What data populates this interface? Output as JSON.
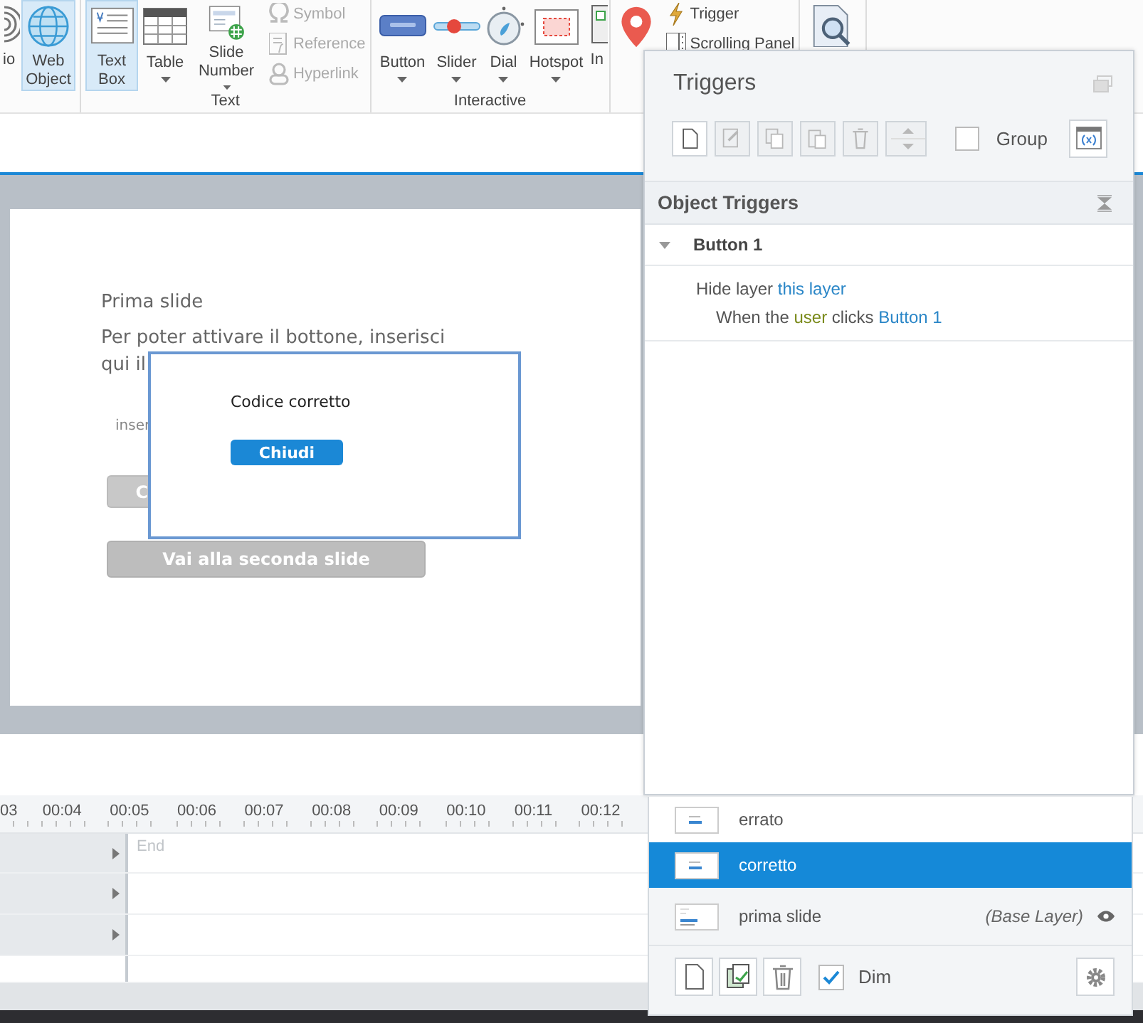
{
  "ribbon": {
    "groups": [
      {
        "tools": [
          {
            "label": "io",
            "selected": false,
            "dropdown": false
          },
          {
            "label": "Web Object",
            "selected": true,
            "dropdown": false
          }
        ]
      },
      {
        "label": "Text",
        "tools": [
          {
            "label": "Text Box",
            "selected": true,
            "dropdown": false
          },
          {
            "label": "Table",
            "selected": false,
            "dropdown": true
          },
          {
            "label": "Slide Number",
            "selected": false,
            "dropdown": true
          }
        ],
        "small_tools": [
          {
            "label": "Symbol",
            "disabled": true
          },
          {
            "label": "Reference",
            "disabled": true
          },
          {
            "label": "Hyperlink",
            "disabled": true
          }
        ]
      },
      {
        "label": "Interactive",
        "tools": [
          {
            "label": "Button",
            "selected": false,
            "dropdown": true
          },
          {
            "label": "Slider",
            "selected": false,
            "dropdown": true
          },
          {
            "label": "Dial",
            "selected": false,
            "dropdown": true
          },
          {
            "label": "Hotspot",
            "selected": false,
            "dropdown": true
          },
          {
            "label": "In",
            "selected": false,
            "dropdown": false
          }
        ]
      },
      {
        "tools": [
          {
            "selected": false,
            "dropdown": false
          }
        ],
        "small_tools": [
          {
            "label": "Trigger",
            "disabled": false
          },
          {
            "label": "Scrolling Panel",
            "disabled": false
          }
        ]
      },
      {
        "tools": [
          {
            "selected": false,
            "dropdown": false
          }
        ]
      }
    ]
  },
  "slide": {
    "title": "Prima slide",
    "body_lines": [
      "Per poter attivare il bottone, inserisci",
      "qui il"
    ],
    "field_text": "inser",
    "submit_button": {
      "label": "C",
      "disabled": true
    },
    "next_button": {
      "label": "Vai alla seconda slide",
      "disabled": true
    }
  },
  "dialog": {
    "message": "Codice corretto",
    "button": "Chiudi"
  },
  "timeline": {
    "ticks": [
      "03",
      "00:04",
      "00:05",
      "00:06",
      "00:07",
      "00:08",
      "00:09",
      "00:10",
      "00:11",
      "00:12"
    ],
    "end_label": "End",
    "rows": [
      {
        "expandable": true
      },
      {
        "expandable": true
      },
      {
        "expandable": true
      },
      {
        "expandable": false
      }
    ]
  },
  "triggers_panel": {
    "title": "Triggers",
    "toolbar": [
      {
        "disabled": false
      },
      {
        "disabled": true
      },
      {
        "disabled": true
      },
      {
        "disabled": true
      },
      {
        "disabled": true
      },
      {
        "disabled": true
      }
    ],
    "group": {
      "label": "Group",
      "checked": false
    },
    "section": {
      "title": "Object Triggers",
      "objects": [
        {
          "name": "Button 1",
          "expanded": true,
          "triggers": [
            {
              "action": [
                {
                  "text": "Hide layer",
                  "kind": "plain"
                },
                {
                  "text": "this layer",
                  "kind": "target"
                }
              ],
              "condition": [
                {
                  "text": "When the",
                  "kind": "plain"
                },
                {
                  "text": "user",
                  "kind": "actor"
                },
                {
                  "text": "clicks",
                  "kind": "plain"
                },
                {
                  "text": "Button 1",
                  "kind": "target"
                }
              ]
            }
          ]
        }
      ]
    }
  },
  "layers": {
    "items": [
      {
        "name": "errato",
        "selected": false,
        "visible": false
      },
      {
        "name": "corretto",
        "selected": true,
        "visible": false
      },
      {
        "name": "prima slide",
        "selected": false,
        "note": "(Base Layer)",
        "visible": true
      }
    ],
    "dim": {
      "label": "Dim",
      "checked": true
    }
  }
}
